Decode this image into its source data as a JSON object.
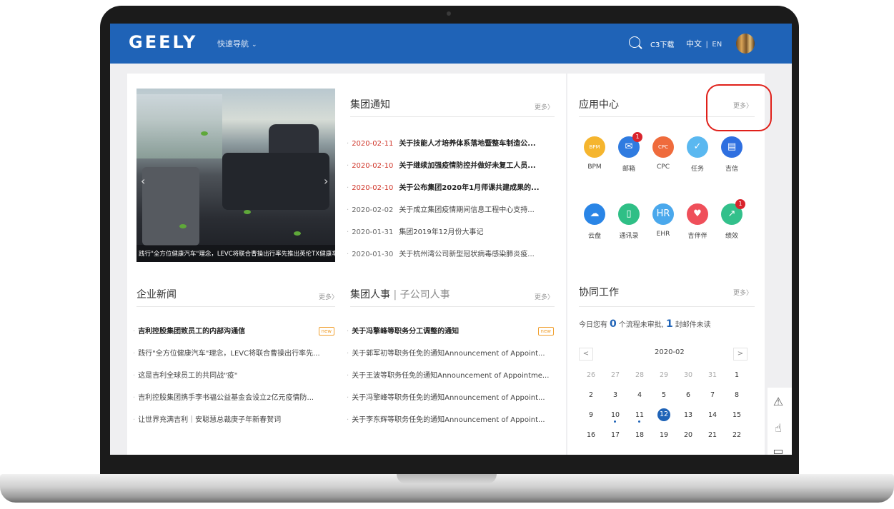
{
  "header": {
    "logo": "GEELY",
    "quick_nav": "快速导航",
    "download": "C3下载",
    "lang_zh": "中文",
    "lang_sep": "|",
    "lang_en": "EN",
    "brand_color": "#1f63b7"
  },
  "carousel": {
    "caption": "践行\"全方位健康汽车\"理念，LEVC将联合曹操出行率先推出英伦TX健康车"
  },
  "notice": {
    "title": "集团通知",
    "more": "更多〉",
    "items": [
      {
        "date": "2020-02-11",
        "text": "关于技能人才培养体系落地暨整车制造公..."
      },
      {
        "date": "2020-02-10",
        "text": "关于继续加强疫情防控并做好未复工人员..."
      },
      {
        "date": "2020-02-10",
        "text": "关于公布集团2020年1月师课共建成果的..."
      },
      {
        "date": "2020-02-02",
        "text": "关于成立集团疫情期间信息工程中心支持..."
      },
      {
        "date": "2020-01-31",
        "text": "集团2019年12月份大事记"
      },
      {
        "date": "2020-01-30",
        "text": "关于杭州湾公司新型冠状病毒感染肺炎疫..."
      }
    ]
  },
  "news": {
    "title": "企业新闻",
    "more": "更多〉",
    "new_tag": "new",
    "items": [
      "吉利控股集团致员工的内部沟通信",
      "践行\"全方位健康汽车\"理念，LEVC将联合曹操出行率先...",
      "这是吉利全球员工的共同战\"疫\"",
      "吉利控股集团携手李书福公益基金会设立2亿元疫情防...",
      "让世界充满吉利｜安聪慧总裁庚子年新春贺词"
    ]
  },
  "personnel": {
    "title_main": "集团人事",
    "title_sep": "|",
    "title_sub": "子公司人事",
    "more": "更多〉",
    "new_tag": "new",
    "items": [
      "关于冯擎峰等职务分工调整的通知",
      "关于郭军初等职务任免的通知Announcement of Appoint...",
      "关于王波等职务任免的通知Announcement of Appointme...",
      "关于冯擎峰等职务任免的通知Announcement of Appoint...",
      "关于李东辉等职务任免的通知Announcement of Appoint..."
    ]
  },
  "apps": {
    "title": "应用中心",
    "more": "更多〉",
    "items": [
      {
        "label": "BPM",
        "icon": "bpm-icon",
        "color": "#f5b52e",
        "glyph": "BPM",
        "badge": ""
      },
      {
        "label": "邮箱",
        "icon": "mail-icon",
        "color": "#2f7be0",
        "glyph": "✉",
        "badge": "1"
      },
      {
        "label": "CPC",
        "icon": "cpc-icon",
        "color": "#ef6b3c",
        "glyph": "CPC",
        "badge": ""
      },
      {
        "label": "任务",
        "icon": "task-icon",
        "color": "#5ab8f0",
        "glyph": "✓",
        "badge": ""
      },
      {
        "label": "吉信",
        "icon": "chat-icon",
        "color": "#2e6fe0",
        "glyph": "▤",
        "badge": ""
      },
      {
        "label": "云盘",
        "icon": "cloud-icon",
        "color": "#2a85e6",
        "glyph": "☁",
        "badge": ""
      },
      {
        "label": "通讯录",
        "icon": "contacts-icon",
        "color": "#2fbf86",
        "glyph": "▯",
        "badge": ""
      },
      {
        "label": "EHR",
        "icon": "ehr-icon",
        "color": "#4aa8ec",
        "glyph": "HR",
        "badge": ""
      },
      {
        "label": "吉伴伴",
        "icon": "heart-icon",
        "color": "#ef4f5a",
        "glyph": "♥",
        "badge": ""
      },
      {
        "label": "绩效",
        "icon": "chart-icon",
        "color": "#33c08b",
        "glyph": "↗",
        "badge": "1"
      }
    ]
  },
  "work": {
    "title": "协同工作",
    "more": "更多〉",
    "stats_prefix": "今日您有",
    "flow_count": "0",
    "stats_mid": "个流程未审批,",
    "mail_count": "1",
    "stats_suffix": "封邮件未读",
    "calendar": {
      "prev": "<",
      "next": ">",
      "month": "2020-02",
      "weeks": [
        [
          "26",
          "27",
          "28",
          "29",
          "30",
          "31",
          "1"
        ],
        [
          "2",
          "3",
          "4",
          "5",
          "6",
          "7",
          "8"
        ],
        [
          "9",
          "10",
          "11",
          "12",
          "13",
          "14",
          "15"
        ],
        [
          "16",
          "17",
          "18",
          "19",
          "20",
          "21",
          "22"
        ]
      ],
      "today": "12"
    }
  },
  "side_tools": [
    "warning-icon",
    "thumb-up-icon",
    "chat-bubble-icon"
  ]
}
